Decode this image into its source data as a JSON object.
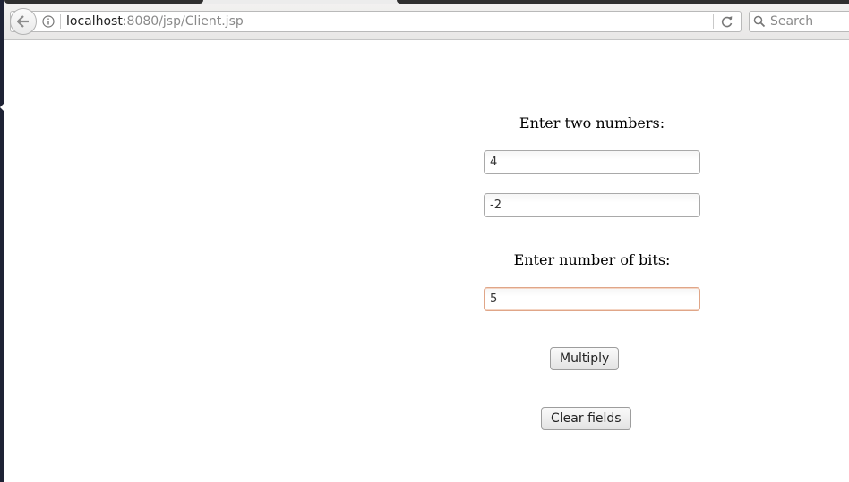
{
  "browser": {
    "url_host": "localhost",
    "url_path": ":8080/jsp/Client.jsp",
    "search_placeholder": "Search"
  },
  "form": {
    "numbers_label": "Enter two numbers:",
    "number1_value": "4",
    "number2_value": "-2",
    "bits_label": "Enter number of bits:",
    "bits_value": "5",
    "multiply_label": "Multiply",
    "clear_label": "Clear fields"
  },
  "icons": {
    "back": "back-arrow-icon",
    "info": "info-icon",
    "reload": "reload-icon",
    "search": "search-icon"
  }
}
